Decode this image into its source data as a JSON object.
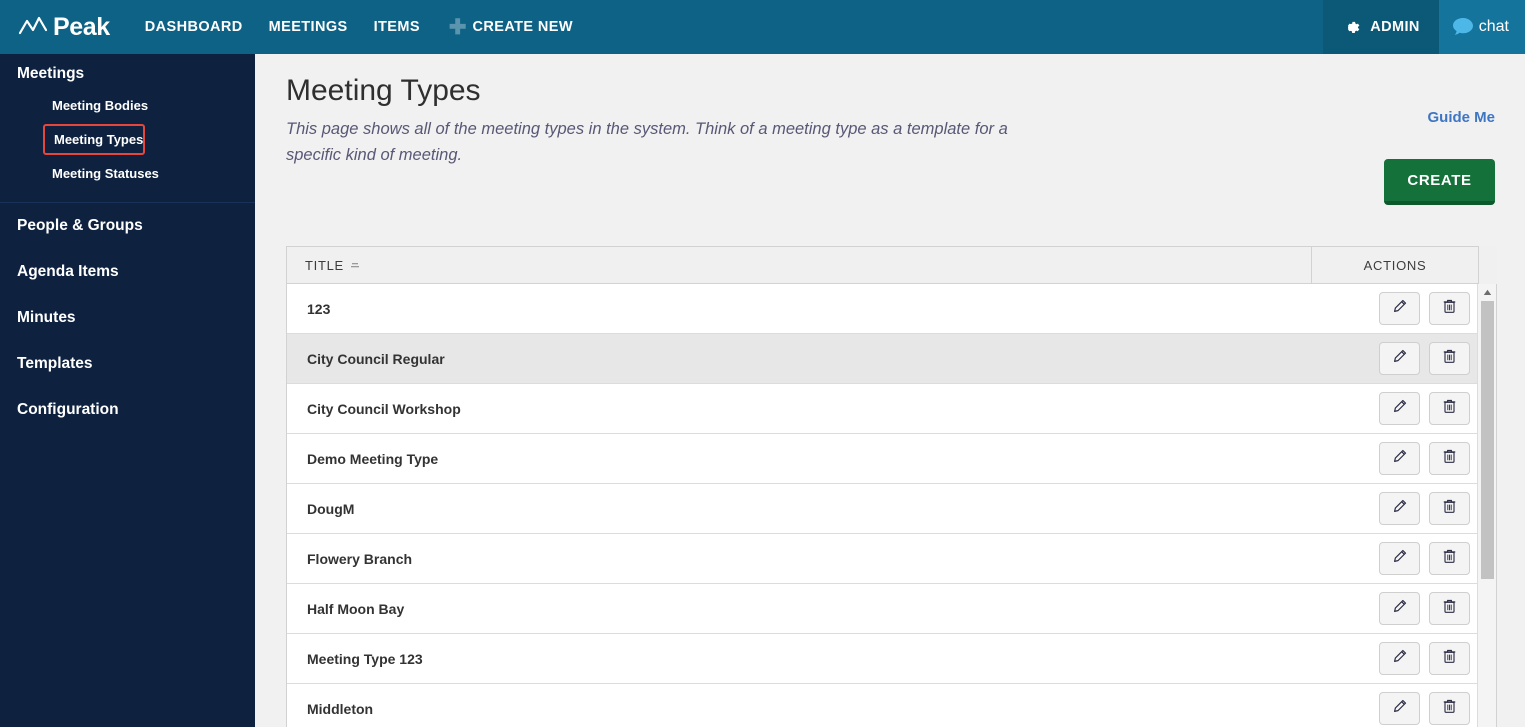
{
  "topbar": {
    "logo_text": "Peak",
    "logo_icon": "peak-zigzag-icon",
    "nav": [
      {
        "label": "DASHBOARD",
        "name": "nav-dashboard"
      },
      {
        "label": "MEETINGS",
        "name": "nav-meetings"
      },
      {
        "label": "ITEMS",
        "name": "nav-items"
      },
      {
        "label": "CREATE NEW",
        "name": "nav-create-new"
      }
    ],
    "plus_icon": "plus-icon",
    "admin_label": "ADMIN",
    "admin_icon": "gear-icon",
    "chat_label": "chat",
    "chat_icon": "speech-bubble-icon",
    "bg_color": "#0d6285",
    "admin_bg_color": "#0b5977",
    "chat_bg_color": "#15749c"
  },
  "sidebar": {
    "bg_color": "#0e2240",
    "group_label": "Meetings",
    "sub_items": [
      {
        "label": "Meeting Bodies",
        "selected": false
      },
      {
        "label": "Meeting Types",
        "selected": true
      },
      {
        "label": "Meeting Statuses",
        "selected": false
      }
    ],
    "highlight_color": "#e8463c",
    "items": [
      {
        "label": "People & Groups"
      },
      {
        "label": "Agenda Items"
      },
      {
        "label": "Minutes"
      },
      {
        "label": "Templates"
      },
      {
        "label": "Configuration"
      }
    ]
  },
  "main": {
    "title": "Meeting Types",
    "description": "This page shows all of the meeting types in the system. Think of a meeting type as a template for a specific kind of meeting.",
    "guide_me_label": "Guide Me",
    "guide_me_color": "#3f76c4",
    "create_button_label": "CREATE",
    "create_button_color": "#14713a"
  },
  "table": {
    "columns": [
      {
        "label": "TITLE",
        "sortable": true,
        "sort_icon": "sort-icon"
      },
      {
        "label": "ACTIONS",
        "sortable": false
      }
    ],
    "edit_icon": "pencil-icon",
    "delete_icon": "trash-icon",
    "rows": [
      {
        "title": "123",
        "hovered": false
      },
      {
        "title": "City Council Regular",
        "hovered": true
      },
      {
        "title": "City Council Workshop",
        "hovered": false
      },
      {
        "title": "Demo Meeting Type",
        "hovered": false
      },
      {
        "title": "DougM",
        "hovered": false
      },
      {
        "title": "Flowery Branch",
        "hovered": false
      },
      {
        "title": "Half Moon Bay",
        "hovered": false
      },
      {
        "title": "Meeting Type 123",
        "hovered": false
      },
      {
        "title": "Middleton",
        "hovered": false
      }
    ],
    "scrollbar": {
      "up_arrow_icon": "scroll-up-arrow-icon"
    }
  }
}
